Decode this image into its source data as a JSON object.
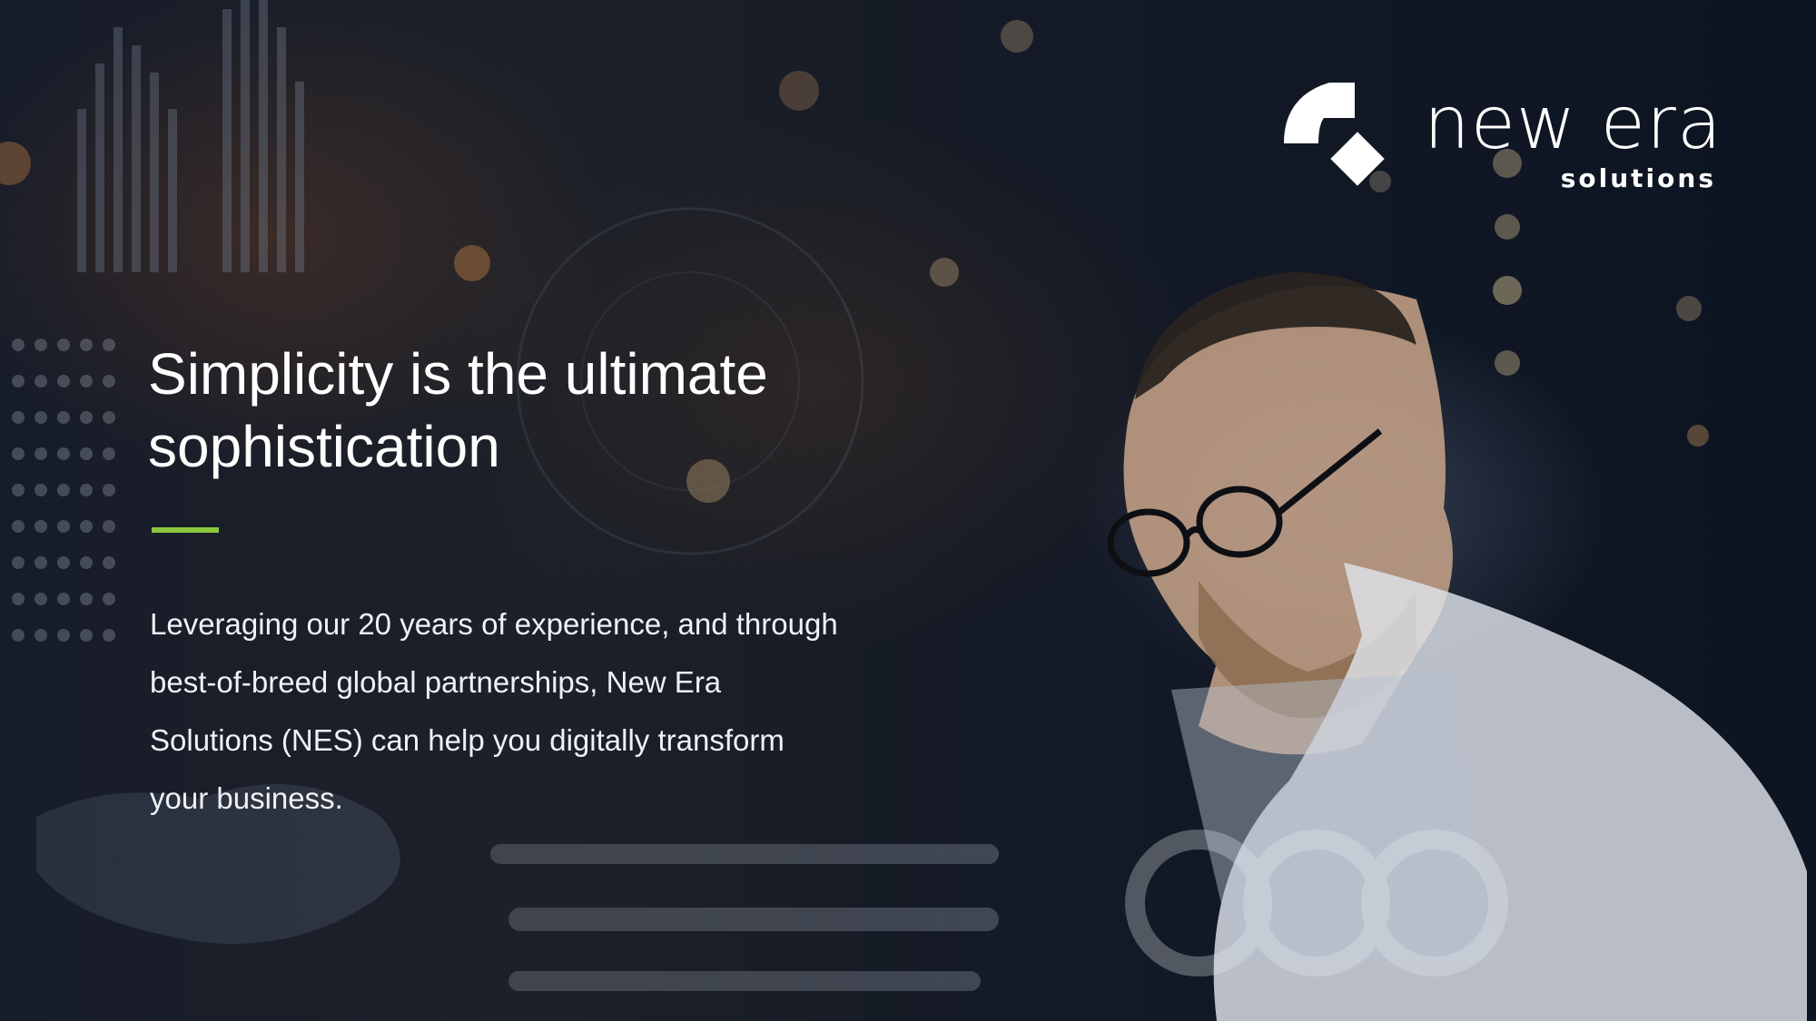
{
  "hero": {
    "headline": "Simplicity is the ultimate sophistication",
    "body": "Leveraging our 20 years of experience, and through best-of-breed global partnerships, New Era Solutions (NES) can help you digitally transform your business.",
    "accent_color": "#8cc63f"
  },
  "logo": {
    "wordmark": "new era",
    "subline": "solutions",
    "icon": "new-era-logo-mark"
  },
  "background": {
    "description_icon": "person-with-glasses-at-laptop-photo"
  }
}
